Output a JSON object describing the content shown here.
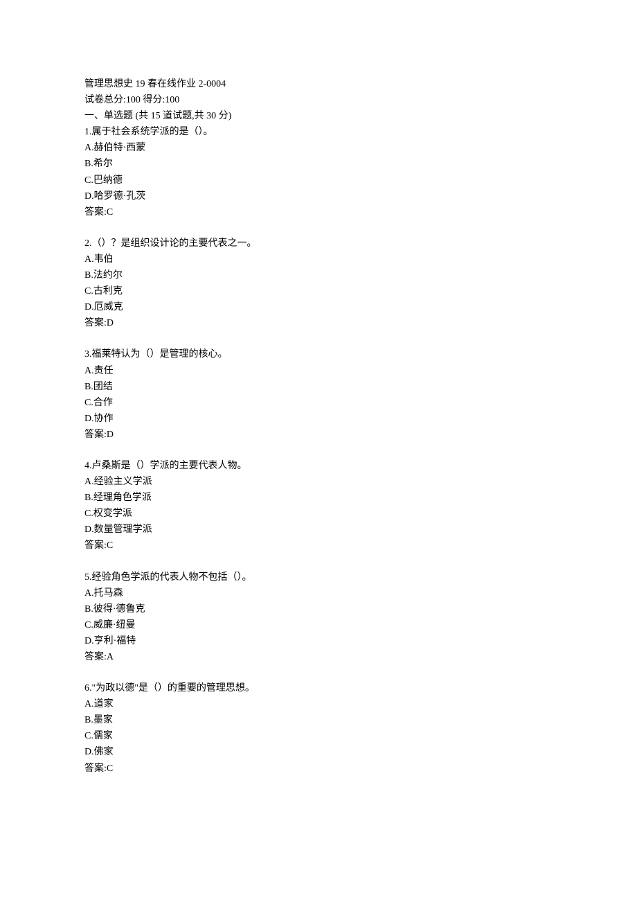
{
  "header": {
    "title": "管理思想史 19 春在线作业 2-0004",
    "score_line": "试卷总分:100    得分:100",
    "section_intro": "一、单选题 (共  15  道试题,共  30  分)"
  },
  "questions": [
    {
      "stem": "1.属于社会系统学派的是（）。",
      "options": [
        "A.赫伯特·西蒙",
        "B.希尔",
        "C.巴纳德",
        "D.哈罗德·孔茨"
      ],
      "answer": "答案:C"
    },
    {
      "stem": "2.（）？是组织设计论的主要代表之一。",
      "options": [
        "A.韦伯",
        "B.法约尔",
        "C.古利克",
        "D.厄威克"
      ],
      "answer": "答案:D"
    },
    {
      "stem": "3.福莱特认为（）是管理的核心。",
      "options": [
        "A.责任",
        "B.团结",
        "C.合作",
        "D.协作"
      ],
      "answer": "答案:D"
    },
    {
      "stem": "4.卢桑斯是（）学派的主要代表人物。",
      "options": [
        "A.经验主义学派",
        "B.经理角色学派",
        "C.权变学派",
        "D.数量管理学派"
      ],
      "answer": "答案:C"
    },
    {
      "stem": "5.经验角色学派的代表人物不包括（）。",
      "options": [
        "A.托马森",
        "B.彼得·德鲁克",
        "C.威廉·纽曼",
        "D.亨利·福特"
      ],
      "answer": "答案:A"
    },
    {
      "stem": "6.\"为政以德\"是（）的重要的管理思想。",
      "options": [
        "A.道家",
        "B.墨家",
        "C.儒家",
        "D.佛家"
      ],
      "answer": "答案:C"
    }
  ]
}
